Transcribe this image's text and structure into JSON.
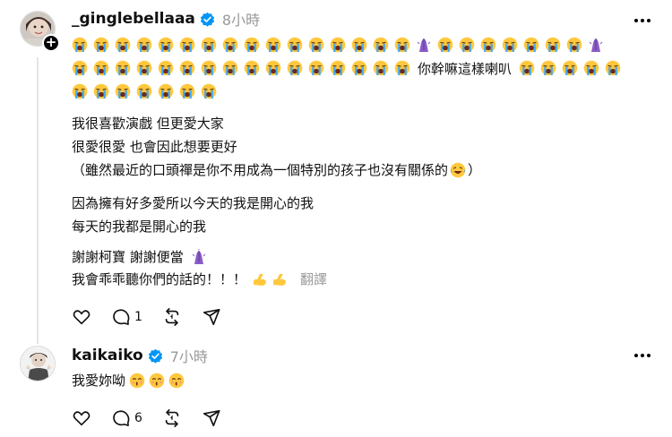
{
  "post1": {
    "username": "_ginglebellaaa",
    "time": "8小時",
    "emoji_rows": [
      [
        "cry",
        "cry",
        "cry",
        "cry",
        "cry",
        "cry",
        "cry",
        "cry",
        "cry",
        "cry",
        "cry",
        "cry",
        "cry",
        "cry",
        "cry",
        "cry",
        "purple-hands",
        "cry",
        "cry",
        "cry",
        "cry",
        "cry",
        "cry",
        "cry",
        "purple-hands"
      ],
      [
        "cry",
        "cry",
        "cry",
        "cry",
        "cry",
        "cry",
        "cry",
        "cry",
        "cry",
        "cry",
        "cry",
        "cry",
        "cry",
        "cry",
        "cry",
        "cry",
        "TEXT",
        "cry",
        "cry",
        "cry",
        "cry",
        "cry"
      ],
      [
        "cry",
        "cry",
        "cry",
        "cry",
        "cry",
        "cry",
        "cry"
      ]
    ],
    "emoji_inline_text": "你幹嘛這樣喇叭",
    "lines": {
      "l1": "我很喜歡演戲 但更愛大家",
      "l2": "很愛很愛 也會因此想要更好",
      "l3": "（雖然最近的口頭禪是你不用成為一個特別的孩子也沒有關係的",
      "l3_end": "）",
      "l4": "因為擁有好多愛所以今天的我是開心的我",
      "l5": "每天的我都是開心的我",
      "l6": "謝謝柯寶 謝謝便當",
      "l7": "我會乖乖聽你們的話的！！！"
    },
    "translate": "翻譯",
    "counts": {
      "like": "",
      "reply": "1",
      "repost": "",
      "share": ""
    }
  },
  "post2": {
    "username": "kaikaiko",
    "time": "7小時",
    "text": "我愛妳呦",
    "counts": {
      "like": "",
      "reply": "6",
      "repost": "",
      "share": ""
    }
  },
  "colors": {
    "verified": "#0095f6",
    "time": "#999999",
    "thread_line": "#e3e3e3",
    "emoji_face": "#ffc83d",
    "tears": "#3da8f5",
    "purple": "#8a5cc7"
  }
}
